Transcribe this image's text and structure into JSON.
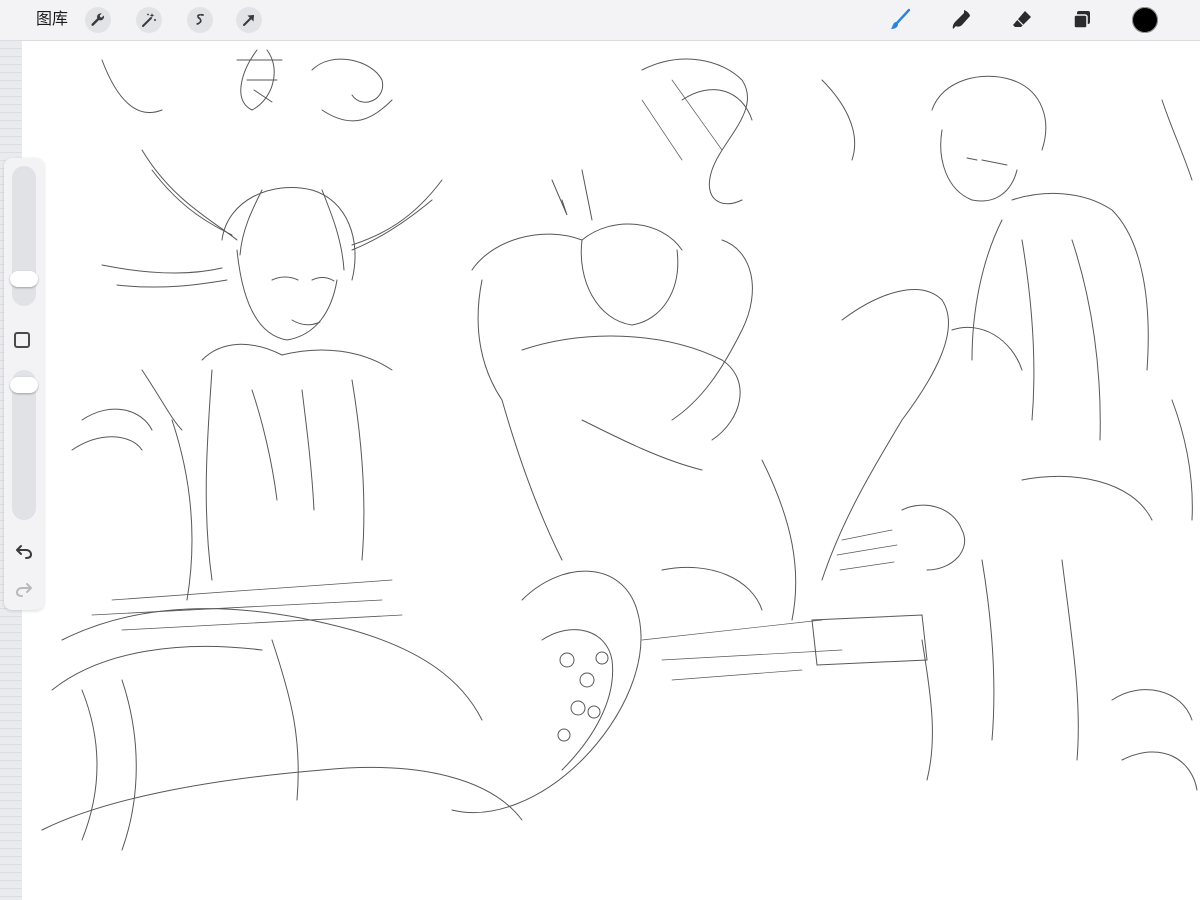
{
  "toolbar": {
    "gallery_label": "图库",
    "left_tools": [
      "actions-wrench-icon",
      "adjustments-magic-icon",
      "selection-icon",
      "transform-arrow-icon"
    ],
    "right_tools": [
      "brush-icon",
      "smudge-icon",
      "eraser-icon",
      "layers-icon"
    ],
    "active_tool": "brush",
    "accent_color": "#2d84d8",
    "current_color": "#000000"
  },
  "sidebar": {
    "brush_size_level": 0.15,
    "opacity_level": 0.95,
    "controls": [
      "brush-size-slider",
      "modify-button",
      "opacity-slider",
      "undo-button",
      "redo-button"
    ]
  }
}
